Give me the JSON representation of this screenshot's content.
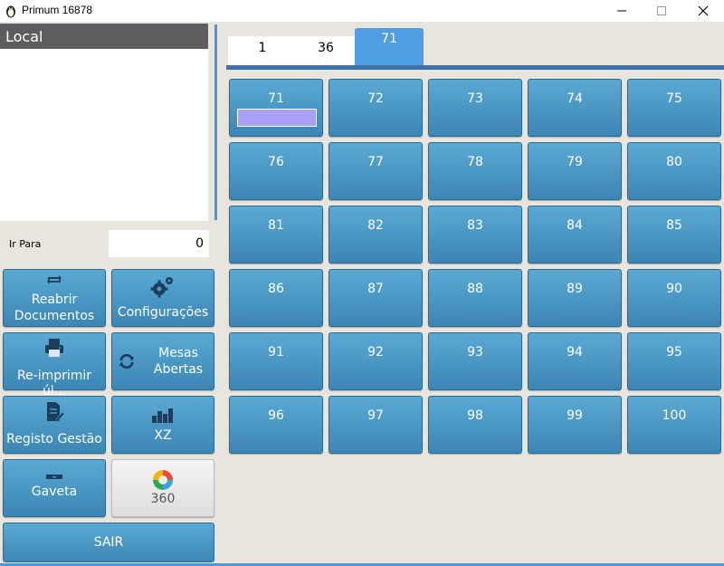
{
  "window": {
    "title": "Primum 16878",
    "icon": "penguin-icon"
  },
  "left_panel": {
    "local_header": "Local",
    "ir_para": {
      "label": "Ir Para",
      "value": "0"
    },
    "buttons": [
      {
        "id": "reabrir",
        "label_lines": [
          "Reabrir",
          "Documentos"
        ],
        "icon": "reopen-arrows-icon"
      },
      {
        "id": "config",
        "label_lines": [
          "Configurações"
        ],
        "icon": "gears-icon"
      },
      {
        "id": "reimprimir",
        "label_lines": [
          "Re-imprimir úl..."
        ],
        "icon": "printer-icon"
      },
      {
        "id": "mesas",
        "label_lines": [
          "Mesas",
          "Abertas"
        ],
        "icon": "refresh-icon"
      },
      {
        "id": "registo",
        "label_lines": [
          "Registo Gestão"
        ],
        "icon": "document-edit-icon"
      },
      {
        "id": "xz",
        "label_lines": [
          "XZ"
        ],
        "icon": "bar-chart-icon"
      },
      {
        "id": "gaveta",
        "label_lines": [
          "Gaveta"
        ],
        "icon": "drawer-icon"
      },
      {
        "id": "c360",
        "label_lines": [
          "360"
        ],
        "icon": "color-ring-icon"
      }
    ],
    "sair_label": "SAIR"
  },
  "tabs": [
    {
      "label": "1"
    },
    {
      "label": "36"
    },
    {
      "label": "71",
      "active": true
    }
  ],
  "tables": [
    "71",
    "72",
    "73",
    "74",
    "75",
    "76",
    "77",
    "78",
    "79",
    "80",
    "81",
    "82",
    "83",
    "84",
    "85",
    "86",
    "87",
    "88",
    "89",
    "90",
    "91",
    "92",
    "93",
    "94",
    "95",
    "96",
    "97",
    "98",
    "99",
    "100"
  ],
  "colors": {
    "button_blue": "#4a97c6",
    "active_tab": "#4f9ee3",
    "occupied_bar": "#a8a0f4",
    "header_gray": "#5d5d5d"
  }
}
